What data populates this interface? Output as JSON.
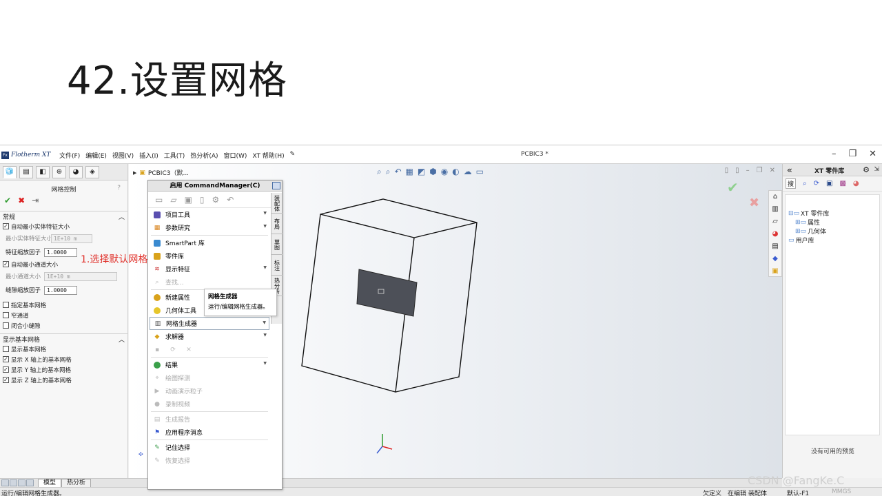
{
  "slide_title": "42.设置网格",
  "app": {
    "logo": "Flotherm XT",
    "logo_mark": "Fx",
    "menu": [
      "文件(F)",
      "编辑(E)",
      "视图(V)",
      "插入(I)",
      "工具(T)",
      "热分析(A)",
      "窗口(W)",
      "XT 帮助(H)"
    ],
    "doc_title": "PCBIC3 *"
  },
  "left_panel": {
    "title": "网格控制",
    "help": "?",
    "sections": {
      "general": "常规",
      "display": "显示基本网格"
    },
    "auto_min_solid": "自动最小实体特征大小",
    "min_solid_label": "最小实体特征大小",
    "min_solid_value": "1E+10 m",
    "feature_scale_label": "特征缩放因子",
    "feature_scale_value": "1.0000",
    "auto_min_channel": "自动最小通道大小",
    "min_channel_label": "最小通道大小",
    "min_channel_value": "1E+10 m",
    "gap_scale_label": "缝隙缩放因子",
    "gap_scale_value": "1.0000",
    "specify_base": "指定基本网格",
    "narrow_channel": "窄通道",
    "close_gap": "闭合小缝隙",
    "show_base": "显示基本网格",
    "show_x": "显示 X 轴上的基本网格",
    "show_y": "显示 Y 轴上的基本网格",
    "show_z": "显示 Z 轴上的基本网格"
  },
  "annotation": "1.选择默认网格",
  "tree_root": "PCBIC3（默...",
  "command_manager": {
    "title": "启用 CommandManager(C)",
    "items": {
      "project_tools": "项目工具",
      "param_study": "参数研究",
      "smartpart": "SmartPart 库",
      "parts_lib": "零件库",
      "show_features": "显示特征",
      "find": "查找...",
      "new_attr": "新建属性",
      "geom_tools": "几何体工具",
      "mesh_gen": "网格生成器",
      "solver": "求解器",
      "results": "结果",
      "plot_probe": "绘图探测",
      "animate": "动画演示粒子",
      "record": "录制视频",
      "report": "生成报告",
      "app_msg": "应用程序消息",
      "remember": "记住选择",
      "restore": "恢复选择"
    },
    "side_tabs": [
      "装配体",
      "布局",
      "草图",
      "标注",
      "热分析"
    ]
  },
  "tooltip": {
    "title": "网格生成器",
    "desc": "运行/编辑网格生成器。"
  },
  "right_panel": {
    "title": "XT 零件库",
    "search": "搜",
    "tree": {
      "root": "XT 零件库",
      "attrs": "属性",
      "geom": "几何体",
      "user": "用户库"
    },
    "preview": "没有可用的预览"
  },
  "bottom_tabs": [
    "模型",
    "热分析"
  ],
  "status": {
    "message": "运行/编辑网格生成器。",
    "underdefined": "欠定义",
    "editing": "在编辑 装配体",
    "config": "默认-F1",
    "units": "MMGS"
  },
  "watermark": "CSDN @FangKe.C"
}
